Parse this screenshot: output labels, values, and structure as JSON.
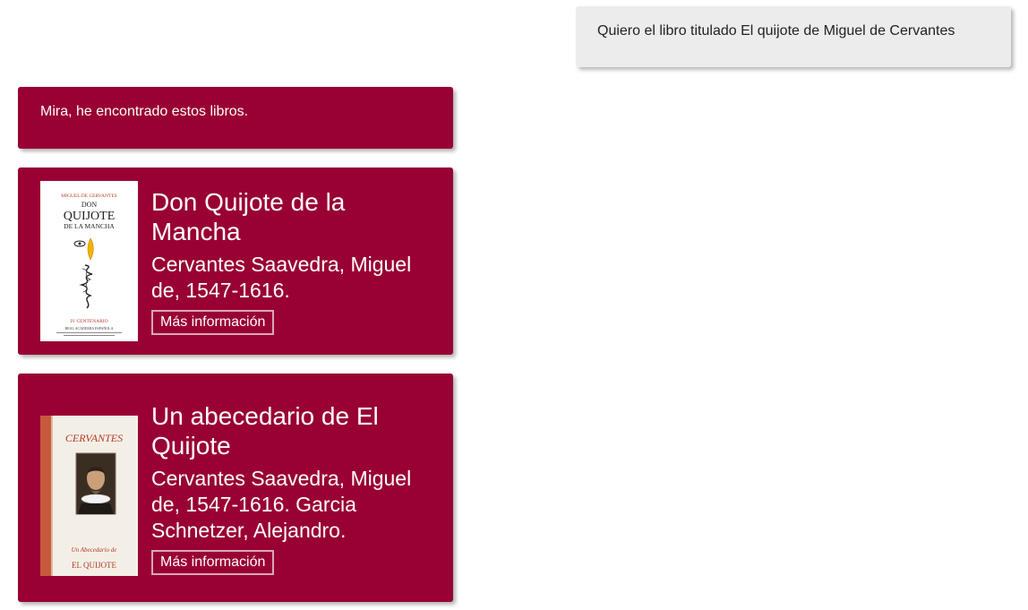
{
  "user_message": {
    "text": "Quiero el libro titulado El quijote de Miguel de Cervantes"
  },
  "bot_message": {
    "text": "Mira, he encontrado estos libros."
  },
  "books": [
    {
      "title": "Don Quijote de la Mancha",
      "authors": "Cervantes Saavedra, Miguel de, 1547-1616.",
      "button_label": "Más información",
      "cover": {
        "top_line": "MIGUEL DE CERVANTES",
        "title_line1": "DON",
        "title_line2": "QUIJOTE",
        "title_line3": "DE LA MANCHA",
        "edition_line": "IV CENTENARIO",
        "publisher_line": "REAL ACADEMIA ESPAÑOLA"
      }
    },
    {
      "title": "Un abecedario de El Quijote",
      "authors": "Cervantes Saavedra, Miguel de, 1547-1616. Garcia Schnetzer, Alejandro.",
      "button_label": "Más información",
      "cover": {
        "top_line": "CERVANTES",
        "bottom_line": "EL QUIJOTE"
      }
    }
  ],
  "colors": {
    "bot_bubble": "#990033",
    "user_bubble": "#ececec",
    "button_border": "#d9a8b8"
  },
  "icons": {
    "cover_1": "book-cover-image",
    "cover_2": "book-cover-image"
  }
}
